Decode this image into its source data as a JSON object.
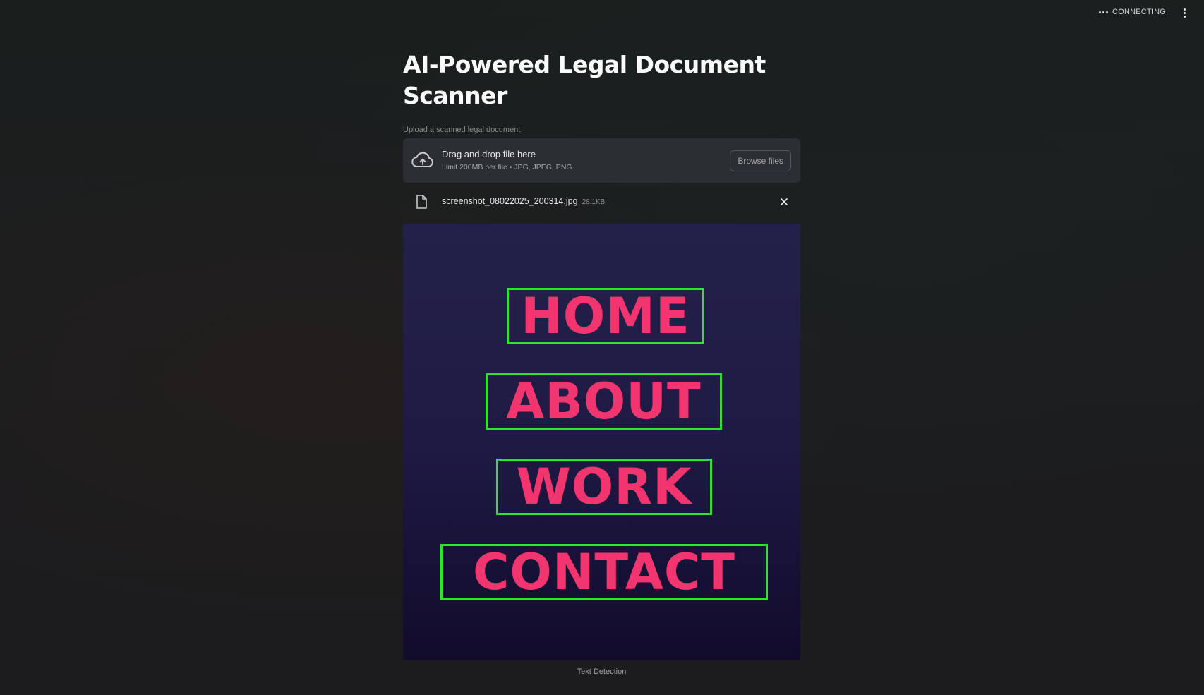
{
  "header": {
    "status_text": "CONNECTING",
    "menu_icon": "vertical-ellipsis-icon"
  },
  "main": {
    "title": "AI-Powered Legal Document Scanner",
    "uploader": {
      "label": "Upload a scanned legal document",
      "drop_title": "Drag and drop file here",
      "drop_limits": "Limit 200MB per file • JPG, JPEG, PNG",
      "browse_label": "Browse files",
      "icon": "cloud-upload-icon"
    },
    "file": {
      "name": "screenshot_08022025_200314.jpg",
      "size": "28.1KB",
      "icon": "file-icon"
    },
    "preview": {
      "words": [
        "HOME",
        "ABOUT",
        "WORK",
        "CONTACT"
      ],
      "box_color": "#2fe32f",
      "text_color": "#f2356f",
      "caption": "Text Detection"
    }
  }
}
